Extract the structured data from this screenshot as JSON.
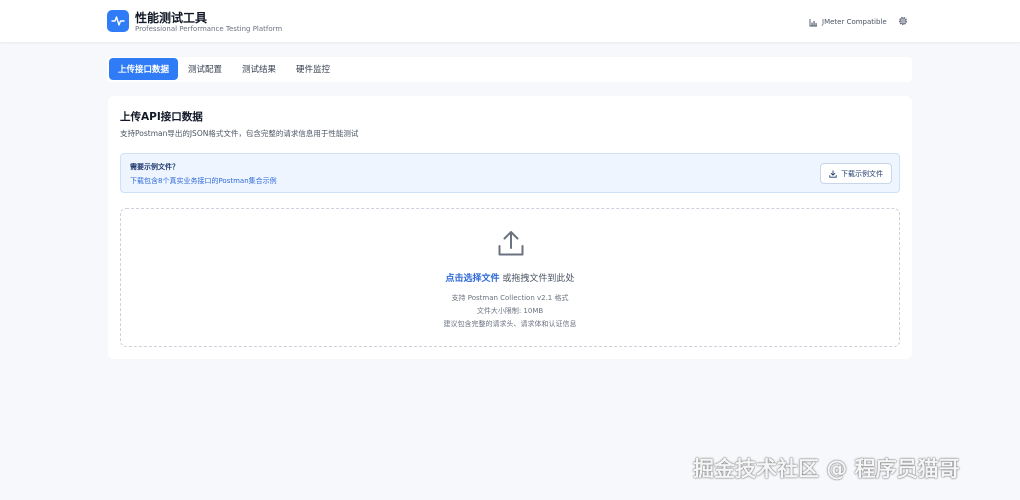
{
  "header": {
    "title": "性能测试工具",
    "subtitle": "Professional Performance Testing Platform",
    "compat_label": "JMeter Compatible",
    "logo_icon": "pulse-icon",
    "compat_icon": "bar-chart-icon",
    "settings_icon": "gear-icon"
  },
  "tabs": [
    {
      "label": "上传接口数据",
      "active": true
    },
    {
      "label": "测试配置",
      "active": false
    },
    {
      "label": "测试结果",
      "active": false
    },
    {
      "label": "硬件监控",
      "active": false
    }
  ],
  "upload": {
    "title": "上传API接口数据",
    "description": "支持Postman导出的JSON格式文件，包含完整的请求信息用于性能测试",
    "sample": {
      "title": "需要示例文件？",
      "description": "下载包含8个真实业务接口的Postman集合示例",
      "button_label": "下载示例文件",
      "button_icon": "download-icon"
    },
    "dropzone": {
      "icon": "upload-icon",
      "link_text": "点击选择文件",
      "drag_text": " 或拖拽文件到此处",
      "hints": [
        "支持 Postman Collection v2.1 格式",
        "文件大小限制: 10MB",
        "建议包含完整的请求头、请求体和认证信息"
      ]
    }
  },
  "watermark": "掘金技术社区 @ 程序员猫哥",
  "colors": {
    "accent": "#2f7cf6",
    "link": "#2f6ad9",
    "info_bg": "#eef5ff",
    "page_bg": "#f6f8fb"
  }
}
